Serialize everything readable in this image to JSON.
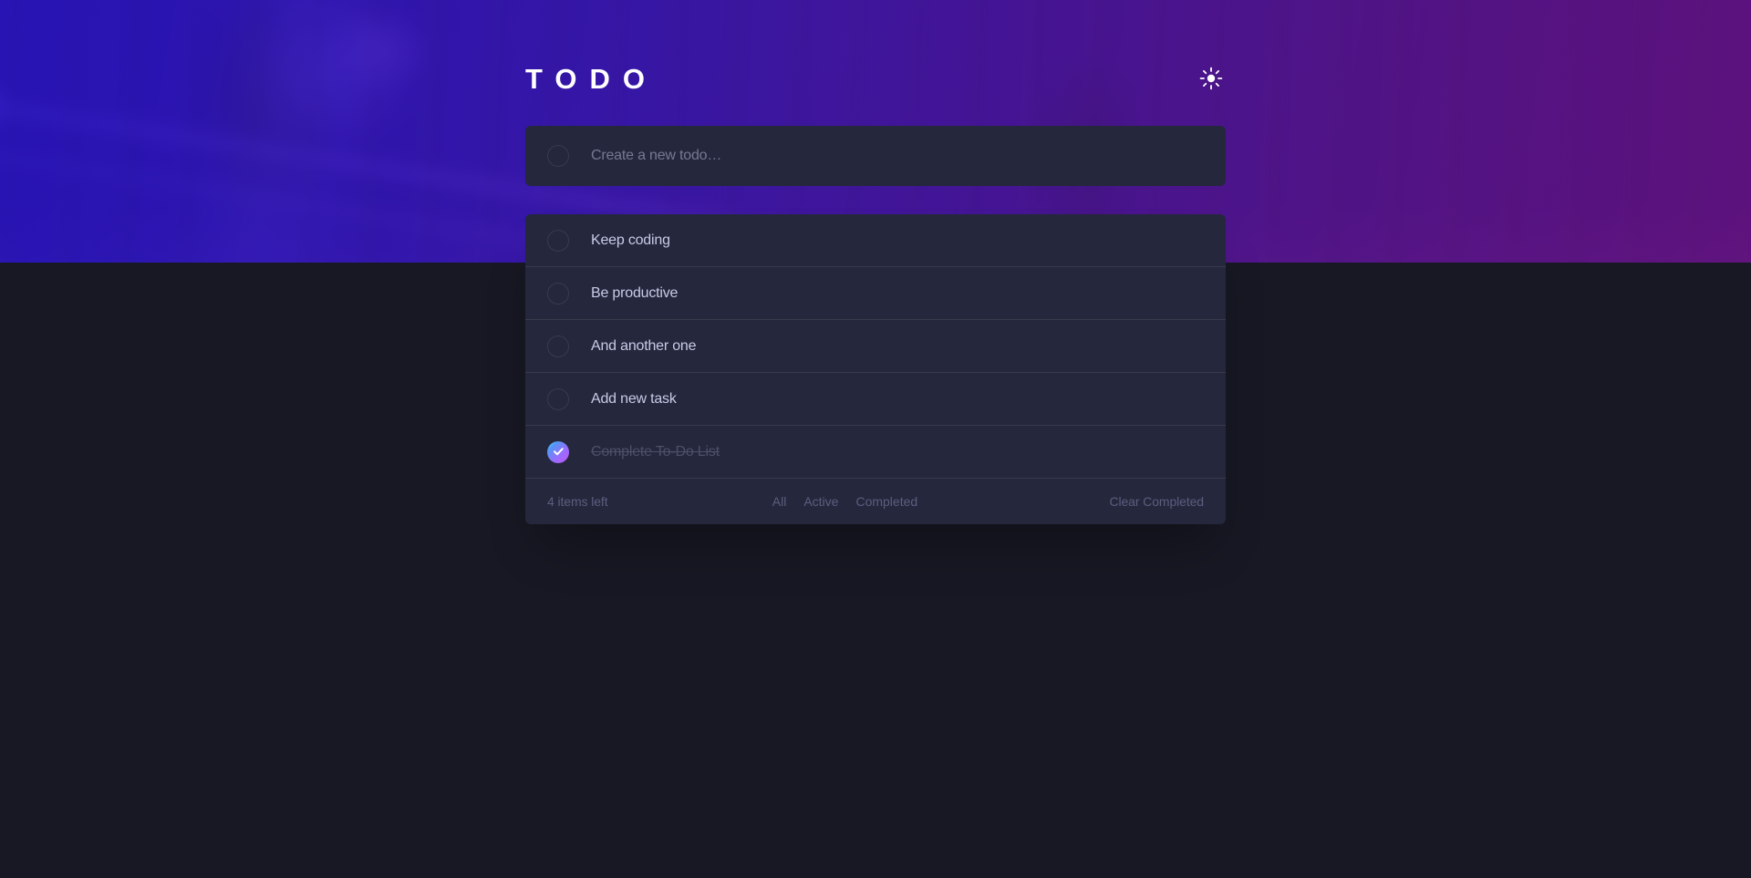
{
  "app": {
    "title": "TODO",
    "theme_mode": "dark",
    "theme_toggle_icon": "sun-icon",
    "accent_color": "#3A7CFD",
    "page_background": "#171823",
    "card_background": "#25273D",
    "divider_color": "#393A4B",
    "text_color": "#C8CBE7",
    "muted_text_color": "#5B5E7E",
    "completed_text_color": "#4D5067",
    "check_gradient_from": "#55DDFF",
    "check_gradient_to": "#C058F3",
    "hero_gradient_from": "#3621B8",
    "hero_gradient_to": "#921C88"
  },
  "create": {
    "placeholder": "Create a new todo…",
    "value": "",
    "checkbox_icon": "empty-circle-icon"
  },
  "todos": [
    {
      "label": "Keep coding",
      "completed": false
    },
    {
      "label": "Be productive",
      "completed": false
    },
    {
      "label": "And another one",
      "completed": false
    },
    {
      "label": "Add new task",
      "completed": false
    },
    {
      "label": "Complete To-Do List",
      "completed": true
    }
  ],
  "footer": {
    "items_left": "4 items left",
    "filters": [
      {
        "label": "All",
        "active": false
      },
      {
        "label": "Active",
        "active": false
      },
      {
        "label": "Completed",
        "active": false
      }
    ],
    "clear_label": "Clear Completed"
  }
}
